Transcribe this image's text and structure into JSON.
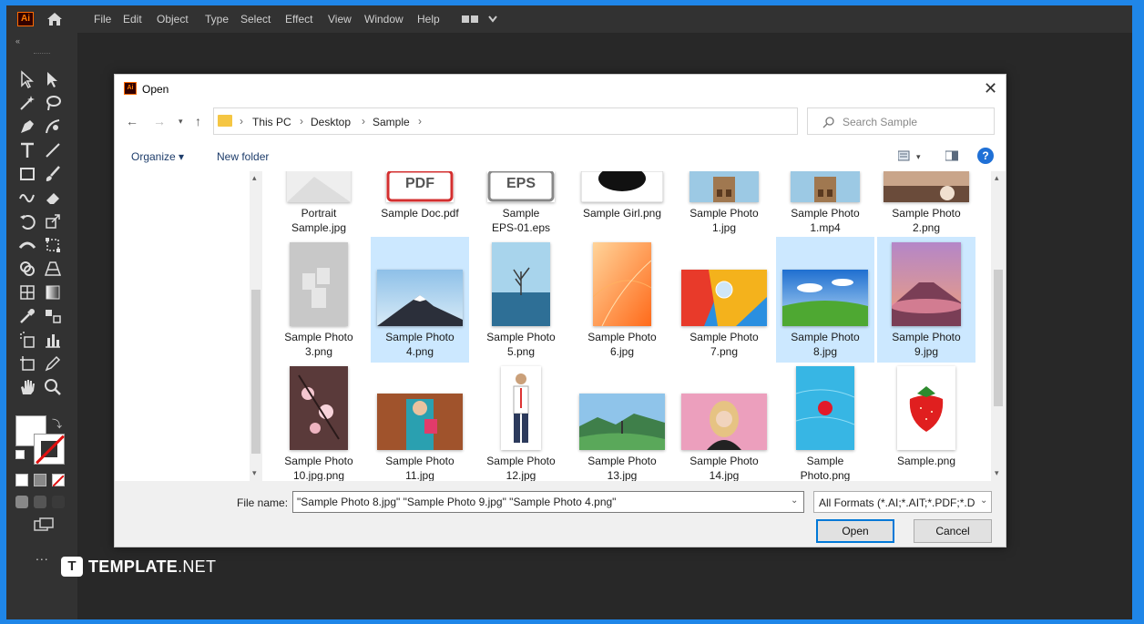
{
  "app": {
    "logo_text": "Ai",
    "menu": [
      "File",
      "Edit",
      "Object",
      "Type",
      "Select",
      "Effect",
      "View",
      "Window",
      "Help"
    ]
  },
  "toolbar": {
    "collapse": "«",
    "more": "..."
  },
  "brand": {
    "logo_letter": "T",
    "name_bold": "TEMPLATE",
    "name_rest": ".NET"
  },
  "dialog": {
    "title": "Open",
    "close_glyph": "✕",
    "breadcrumb": [
      "This PC",
      "Desktop",
      "Sample"
    ],
    "search_placeholder": "Search Sample",
    "organize_label": "Organize ▾",
    "new_folder_label": "New folder",
    "files": [
      {
        "name": "Portrait Sample.jpg",
        "lines": [
          "Portrait",
          "Sample.jpg"
        ],
        "selected": false,
        "thumb": "portrait"
      },
      {
        "name": "Sample Doc.pdf",
        "lines": [
          "Sample Doc.pdf"
        ],
        "selected": false,
        "thumb": "pdf",
        "thumb_label": "PDF"
      },
      {
        "name": "Sample EPS-01.eps",
        "lines": [
          "Sample",
          "EPS-01.eps"
        ],
        "selected": false,
        "thumb": "eps",
        "thumb_label": "EPS"
      },
      {
        "name": "Sample Girl.png",
        "lines": [
          "Sample Girl.png"
        ],
        "selected": false,
        "thumb": "girl"
      },
      {
        "name": "Sample Photo 1.jpg",
        "lines": [
          "Sample Photo",
          "1.jpg"
        ],
        "selected": false,
        "thumb": "photo1"
      },
      {
        "name": "Sample Photo 1.mp4",
        "lines": [
          "Sample Photo",
          "1.mp4"
        ],
        "selected": false,
        "thumb": "photo1"
      },
      {
        "name": "Sample Photo 2.png",
        "lines": [
          "Sample Photo",
          "2.png"
        ],
        "selected": false,
        "thumb": "photo2"
      },
      {
        "name": "Sample Photo 3.png",
        "lines": [
          "Sample Photo",
          "3.png"
        ],
        "selected": false,
        "thumb": "gray"
      },
      {
        "name": "Sample Photo 4.png",
        "lines": [
          "Sample Photo",
          "4.png"
        ],
        "selected": true,
        "thumb": "mountain"
      },
      {
        "name": "Sample Photo 5.png",
        "lines": [
          "Sample Photo",
          "5.png"
        ],
        "selected": false,
        "thumb": "tree"
      },
      {
        "name": "Sample Photo 6.jpg",
        "lines": [
          "Sample Photo",
          "6.jpg"
        ],
        "selected": false,
        "thumb": "orange"
      },
      {
        "name": "Sample Photo 7.png",
        "lines": [
          "Sample Photo",
          "7.png"
        ],
        "selected": false,
        "thumb": "geo"
      },
      {
        "name": "Sample Photo 8.jpg",
        "lines": [
          "Sample Photo",
          "8.jpg"
        ],
        "selected": true,
        "thumb": "field"
      },
      {
        "name": "Sample Photo 9.jpg",
        "lines": [
          "Sample Photo",
          "9.jpg"
        ],
        "selected": true,
        "thumb": "volcano"
      },
      {
        "name": "Sample Photo 10.jpg.png",
        "lines": [
          "Sample Photo",
          "10.jpg.png"
        ],
        "selected": false,
        "thumb": "blossom"
      },
      {
        "name": "Sample Photo 11.jpg",
        "lines": [
          "Sample Photo",
          "11.jpg"
        ],
        "selected": false,
        "thumb": "woman"
      },
      {
        "name": "Sample Photo 12.jpg",
        "lines": [
          "Sample Photo",
          "12.jpg"
        ],
        "selected": false,
        "thumb": "man"
      },
      {
        "name": "Sample Photo 13.jpg",
        "lines": [
          "Sample Photo",
          "13.jpg"
        ],
        "selected": false,
        "thumb": "valley"
      },
      {
        "name": "Sample Photo 14.jpg",
        "lines": [
          "Sample Photo",
          "14.jpg"
        ],
        "selected": false,
        "thumb": "blonde"
      },
      {
        "name": "Sample Photo.png",
        "lines": [
          "Sample",
          "Photo.png"
        ],
        "selected": false,
        "thumb": "pool"
      },
      {
        "name": "Sample.png",
        "lines": [
          "Sample.png"
        ],
        "selected": false,
        "thumb": "strawberry"
      }
    ],
    "file_name_label": "File name:",
    "file_name_value": "\"Sample Photo 8.jpg\" \"Sample Photo 9.jpg\" \"Sample Photo 4.png\"",
    "filter_value": "All Formats (*.AI;*.AIT;*.PDF;*.D",
    "open_label": "Open",
    "cancel_label": "Cancel"
  },
  "colors": {
    "outer_border": "#1f86e8",
    "selection": "#cce8ff",
    "primary_button_border": "#0078d7"
  }
}
